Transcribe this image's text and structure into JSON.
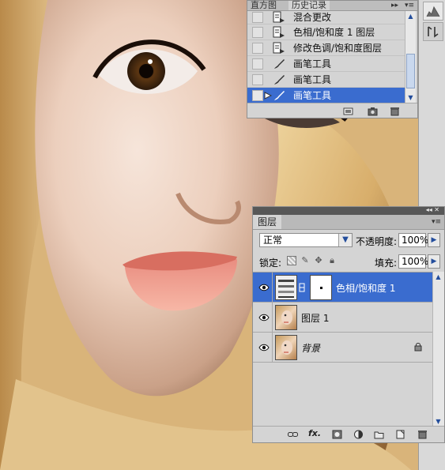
{
  "history_panel": {
    "tabs": [
      "直方图",
      "历史记录"
    ],
    "active_tab": 1,
    "items": [
      {
        "label": "混合更改",
        "icon": "document-icon"
      },
      {
        "label": "色相/饱和度 1 图层",
        "icon": "document-icon"
      },
      {
        "label": "修改色调/饱和度图层",
        "icon": "document-icon"
      },
      {
        "label": "画笔工具",
        "icon": "brush-icon"
      },
      {
        "label": "画笔工具",
        "icon": "brush-icon"
      },
      {
        "label": "画笔工具",
        "icon": "brush-icon",
        "selected": true
      }
    ]
  },
  "layers_panel": {
    "tab": "图层",
    "blend_mode": "正常",
    "opacity_label": "不透明度:",
    "opacity": "100%",
    "lock_label": "锁定:",
    "fill_label": "填充:",
    "fill": "100%",
    "layers": [
      {
        "name": "色相/饱和度 1",
        "type": "adjustment",
        "selected": true
      },
      {
        "name": "图层 1",
        "type": "pixel"
      },
      {
        "name": "背景",
        "type": "background",
        "locked": true
      }
    ]
  },
  "colors": {
    "selection": "#3a6ccf",
    "panel_bg": "#d4d4d4"
  }
}
